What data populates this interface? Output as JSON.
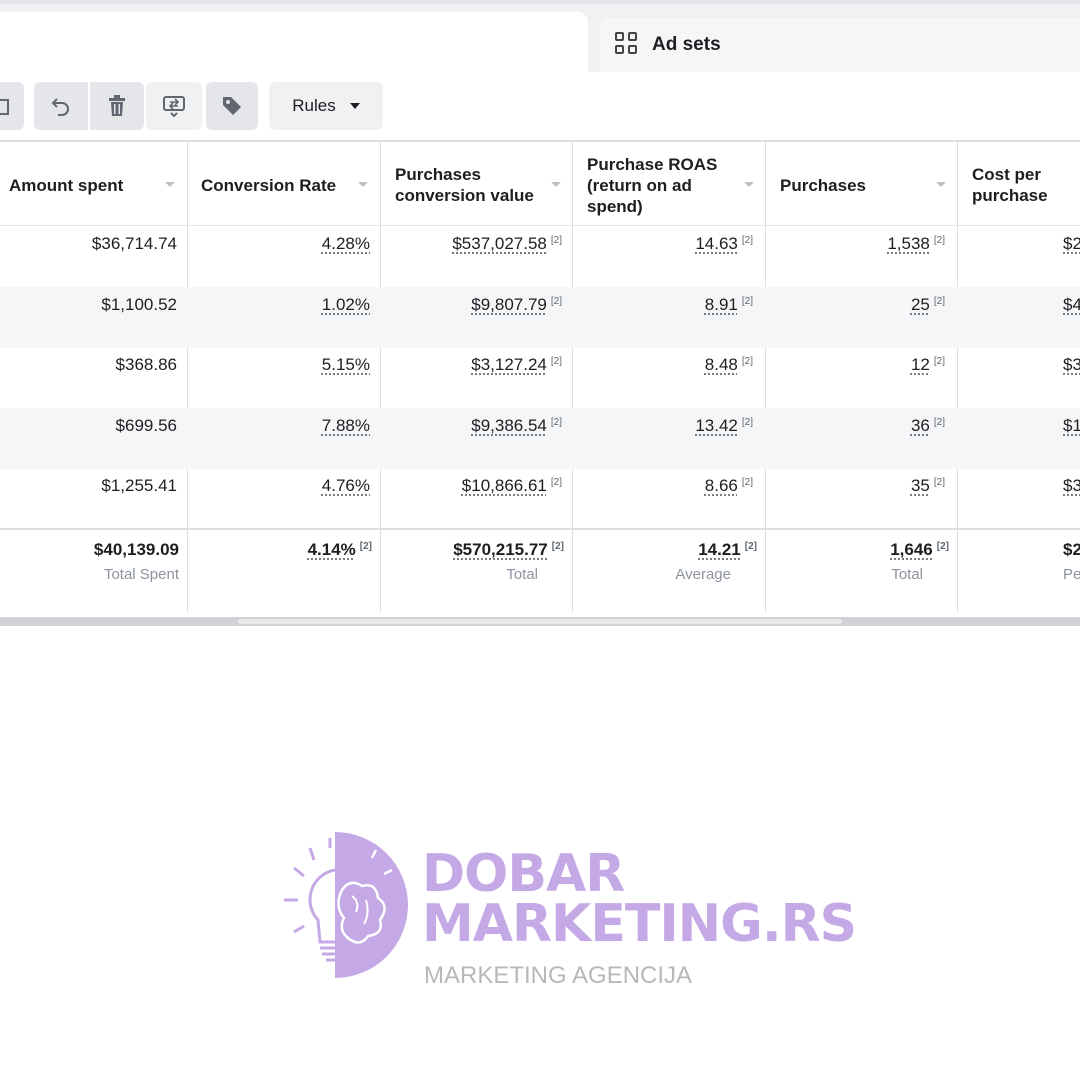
{
  "tabs": {
    "ad_sets_label": "Ad sets"
  },
  "toolbar": {
    "rules_label": "Rules"
  },
  "columns": [
    {
      "label": "Amount spent"
    },
    {
      "label": "Conversion Rate"
    },
    {
      "label": "Purchases conversion value"
    },
    {
      "label": "Purchase ROAS (return on ad spend)"
    },
    {
      "label": "Purchases"
    },
    {
      "label": "Cost per purchase"
    }
  ],
  "footnote_marker": "[2]",
  "rows": [
    {
      "amount_spent": "$36,714.74",
      "conversion_rate": "4.28%",
      "conv_value": "$537,027.58",
      "roas": "14.63",
      "purchases": "1,538",
      "cost_per_purchase": "$2"
    },
    {
      "amount_spent": "$1,100.52",
      "conversion_rate": "1.02%",
      "conv_value": "$9,807.79",
      "roas": "8.91",
      "purchases": "25",
      "cost_per_purchase": "$4"
    },
    {
      "amount_spent": "$368.86",
      "conversion_rate": "5.15%",
      "conv_value": "$3,127.24",
      "roas": "8.48",
      "purchases": "12",
      "cost_per_purchase": "$3"
    },
    {
      "amount_spent": "$699.56",
      "conversion_rate": "7.88%",
      "conv_value": "$9,386.54",
      "roas": "13.42",
      "purchases": "36",
      "cost_per_purchase": "$1"
    },
    {
      "amount_spent": "$1,255.41",
      "conversion_rate": "4.76%",
      "conv_value": "$10,866.61",
      "roas": "8.66",
      "purchases": "35",
      "cost_per_purchase": "$3"
    }
  ],
  "totals": {
    "amount_spent": "$40,139.09",
    "amount_spent_label": "Total Spent",
    "conversion_rate": "4.14%",
    "conv_value": "$570,215.77",
    "conv_value_label": "Total",
    "roas": "14.21",
    "roas_label": "Average",
    "purchases": "1,646",
    "purchases_label": "Total",
    "cost_per_purchase": "$2",
    "cost_per_purchase_label": "Per A"
  },
  "watermark": {
    "line1": "DOBAR",
    "line2": "MARKETING.RS",
    "tagline": "MARKETING AGENCIJA",
    "color": "#c5a9e6"
  }
}
